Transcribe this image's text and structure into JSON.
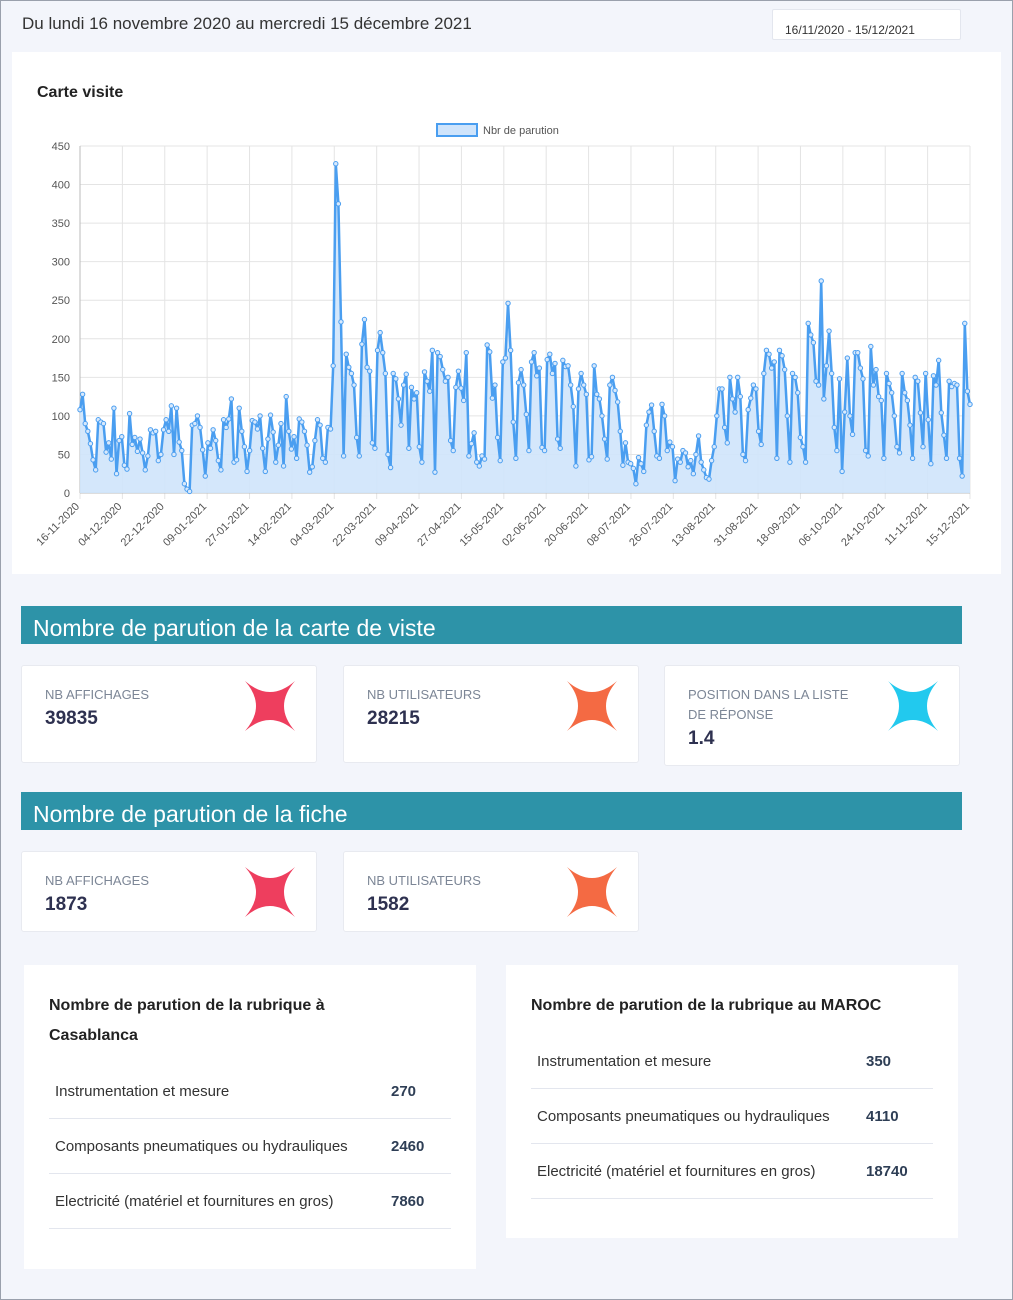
{
  "header": {
    "range_text": "Du lundi  16 novembre 2020  au mercredi 15 décembre 2021",
    "range_input": "16/11/2020 - 15/12/2021"
  },
  "chart_card": {
    "title": "Carte visite"
  },
  "chart_data": {
    "type": "line",
    "fill": true,
    "legend": "top-center",
    "grid": true,
    "color": "#4a9ef0",
    "fill_color": "#cfe4fb",
    "title": "",
    "xlabel": "",
    "ylabel": "",
    "ylim": [
      0,
      450
    ],
    "y_ticks": [
      "0",
      "50",
      "100",
      "150",
      "200",
      "250",
      "300",
      "350",
      "400",
      "450"
    ],
    "x_tick_labels": [
      "16-11-2020",
      "04-12-2020",
      "22-12-2020",
      "09-01-2021",
      "27-01-2021",
      "14-02-2021",
      "04-03-2021",
      "22-03-2021",
      "09-04-2021",
      "27-04-2021",
      "15-05-2021",
      "02-06-2021",
      "20-06-2021",
      "08-07-2021",
      "26-07-2021",
      "13-08-2021",
      "31-08-2021",
      "18-09-2021",
      "06-10-2021",
      "24-10-2021",
      "11-11-2021",
      "15-12-2021"
    ],
    "series": [
      {
        "name": "Nbr de parution",
        "values": [
          108,
          128,
          90,
          80,
          64,
          43,
          30,
          95,
          92,
          90,
          53,
          65,
          44,
          110,
          25,
          68,
          73,
          36,
          31,
          103,
          63,
          72,
          54,
          70,
          52,
          30,
          48,
          82,
          78,
          80,
          42,
          50,
          82,
          95,
          80,
          113,
          50,
          110,
          66,
          55,
          12,
          5,
          2,
          88,
          90,
          100,
          85,
          56,
          22,
          65,
          58,
          82,
          68,
          42,
          30,
          95,
          85,
          96,
          122,
          40,
          43,
          110,
          80,
          60,
          28,
          55,
          94,
          92,
          83,
          100,
          58,
          28,
          70,
          101,
          79,
          40,
          62,
          90,
          35,
          125,
          80,
          57,
          73,
          45,
          96,
          92,
          80,
          62,
          27,
          34,
          68,
          95,
          88,
          45,
          40,
          85,
          83,
          165,
          427,
          375,
          222,
          48,
          180,
          163,
          155,
          140,
          72,
          48,
          193,
          225,
          163,
          158,
          65,
          58,
          185,
          208,
          182,
          155,
          50,
          33,
          155,
          148,
          122,
          88,
          140,
          154,
          58,
          137,
          122,
          130,
          60,
          40,
          157,
          145,
          132,
          185,
          27,
          182,
          177,
          160,
          145,
          150,
          68,
          55,
          137,
          158,
          136,
          120,
          182,
          48,
          64,
          78,
          40,
          35,
          48,
          44,
          192,
          183,
          123,
          140,
          72,
          42,
          170,
          175,
          246,
          185,
          92,
          45,
          143,
          160,
          140,
          102,
          55,
          170,
          182,
          152,
          162,
          59,
          55,
          173,
          180,
          155,
          168,
          70,
          58,
          172,
          164,
          165,
          140,
          112,
          35,
          135,
          155,
          140,
          128,
          43,
          47,
          165,
          128,
          122,
          100,
          70,
          44,
          140,
          150,
          133,
          118,
          80,
          36,
          65,
          40,
          38,
          32,
          12,
          46,
          38,
          28,
          88,
          105,
          114,
          80,
          48,
          45,
          115,
          100,
          55,
          66,
          60,
          16,
          44,
          40,
          55,
          52,
          34,
          42,
          25,
          50,
          74,
          40,
          30,
          20,
          18,
          42,
          60,
          100,
          135,
          135,
          85,
          65,
          150,
          122,
          105,
          150,
          125,
          50,
          42,
          108,
          123,
          140,
          135,
          80,
          63,
          155,
          185,
          180,
          162,
          170,
          45,
          185,
          178,
          160,
          100,
          40,
          155,
          150,
          130,
          72,
          60,
          40,
          220,
          205,
          195,
          145,
          140,
          275,
          122,
          165,
          210,
          155,
          85,
          55,
          148,
          28,
          105,
          175,
          100,
          76,
          182,
          182,
          162,
          148,
          55,
          48,
          190,
          140,
          160,
          125,
          120,
          45,
          155,
          142,
          130,
          100,
          60,
          52,
          155,
          130,
          120,
          88,
          45,
          150,
          145,
          104,
          60,
          155,
          95,
          38,
          152,
          140,
          172,
          104,
          75,
          45,
          145,
          138,
          142,
          140,
          45,
          22,
          220,
          132,
          115
        ]
      }
    ]
  },
  "section1": {
    "title": "Nombre de parution de la carte de viste",
    "stats": [
      {
        "label": "NB AFFICHAGES",
        "value": "39835",
        "color": "#ee3e5e"
      },
      {
        "label": "NB UTILISATEURS",
        "value": "28215",
        "color": "#f46a43"
      },
      {
        "label": "POSITION DANS LA LISTE DE RÉPONSE",
        "value": "1.4",
        "color": "#22c9ee"
      }
    ]
  },
  "section2": {
    "title": "Nombre de parution de la fiche",
    "stats": [
      {
        "label": "NB AFFICHAGES",
        "value": "1873",
        "color": "#ee3e5e"
      },
      {
        "label": "NB UTILISATEURS",
        "value": "1582",
        "color": "#f46a43"
      }
    ]
  },
  "table_casa": {
    "title": "Nombre de parution de la rubrique à Casablanca",
    "rows": [
      {
        "name": "Instrumentation  et mesure",
        "value": "270"
      },
      {
        "name": "Composants pneumatiques ou hydrauliques",
        "value": "2460"
      },
      {
        "name": "Electricité (matériel et fournitures  en gros)",
        "value": "7860"
      }
    ]
  },
  "table_maroc": {
    "title": "Nombre de parution de la rubrique au MAROC",
    "rows": [
      {
        "name": "Instrumentation  et mesure",
        "value": "350"
      },
      {
        "name": "Composants pneumatiques ou hydrauliques",
        "value": "4110"
      },
      {
        "name": "Electricité (matériel et fournitures  en gros)",
        "value": "18740"
      }
    ]
  }
}
